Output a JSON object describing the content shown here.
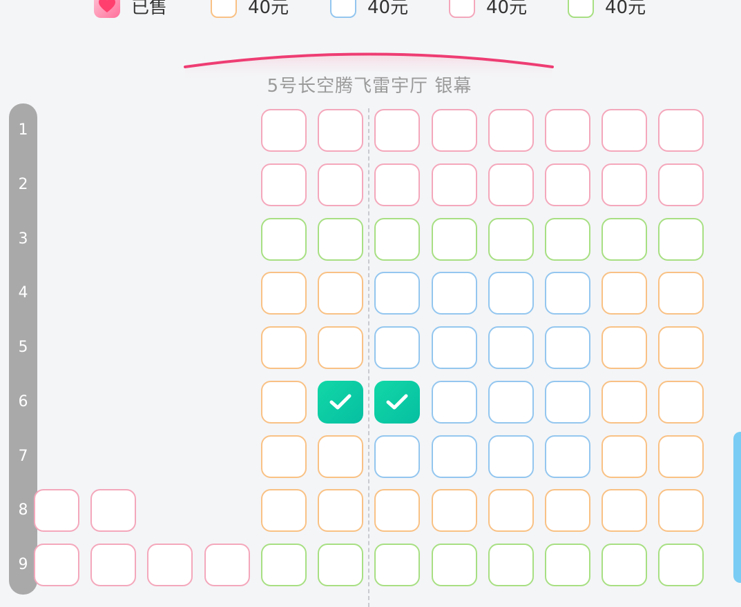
{
  "legend": {
    "items": [
      {
        "label": "已售",
        "swatch": "sold",
        "icon": "heart-icon"
      },
      {
        "label": "40元",
        "color": "#f9c184"
      },
      {
        "label": "40元",
        "color": "#93c6ef"
      },
      {
        "label": "40元",
        "color": "#f4a7bb"
      },
      {
        "label": "40元",
        "color": "#a7df82"
      }
    ]
  },
  "screen": {
    "label": "5号长空腾飞雷宇厅 银幕",
    "curve_color": "#ee3d73"
  },
  "rows": [
    "1",
    "2",
    "3",
    "4",
    "5",
    "6",
    "7",
    "8",
    "9"
  ],
  "seat_colors": {
    "pink": "#f4a7bb",
    "green": "#a7df82",
    "orange": "#f9c184",
    "blue": "#93c6ef",
    "selected": "#0fcca6"
  },
  "seat_map": [
    {
      "row": "1",
      "seats": [
        null,
        null,
        null,
        null,
        "pink",
        "pink",
        "pink",
        "pink",
        "pink",
        "pink",
        "pink",
        "pink"
      ]
    },
    {
      "row": "2",
      "seats": [
        null,
        null,
        null,
        null,
        "pink",
        "pink",
        "pink",
        "pink",
        "pink",
        "pink",
        "pink",
        "pink"
      ]
    },
    {
      "row": "3",
      "seats": [
        null,
        null,
        null,
        null,
        "green",
        "green",
        "green",
        "green",
        "green",
        "green",
        "green",
        "green"
      ]
    },
    {
      "row": "4",
      "seats": [
        null,
        null,
        null,
        null,
        "orange",
        "orange",
        "blue",
        "blue",
        "blue",
        "blue",
        "orange",
        "orange"
      ]
    },
    {
      "row": "5",
      "seats": [
        null,
        null,
        null,
        null,
        "orange",
        "orange",
        "blue",
        "blue",
        "blue",
        "blue",
        "orange",
        "orange"
      ]
    },
    {
      "row": "6",
      "seats": [
        null,
        null,
        null,
        null,
        "orange",
        "selected",
        "selected",
        "blue",
        "blue",
        "blue",
        "orange",
        "orange"
      ]
    },
    {
      "row": "7",
      "seats": [
        null,
        null,
        null,
        null,
        "orange",
        "orange",
        "blue",
        "blue",
        "blue",
        "blue",
        "orange",
        "orange"
      ]
    },
    {
      "row": "8",
      "seats": [
        "pink",
        "pink",
        null,
        null,
        "orange",
        "orange",
        "orange",
        "orange",
        "orange",
        "orange",
        "orange",
        "orange"
      ]
    },
    {
      "row": "9",
      "seats": [
        "pink",
        "pink",
        "pink",
        "pink",
        "green",
        "green",
        "green",
        "green",
        "green",
        "green",
        "green",
        "green"
      ]
    }
  ]
}
